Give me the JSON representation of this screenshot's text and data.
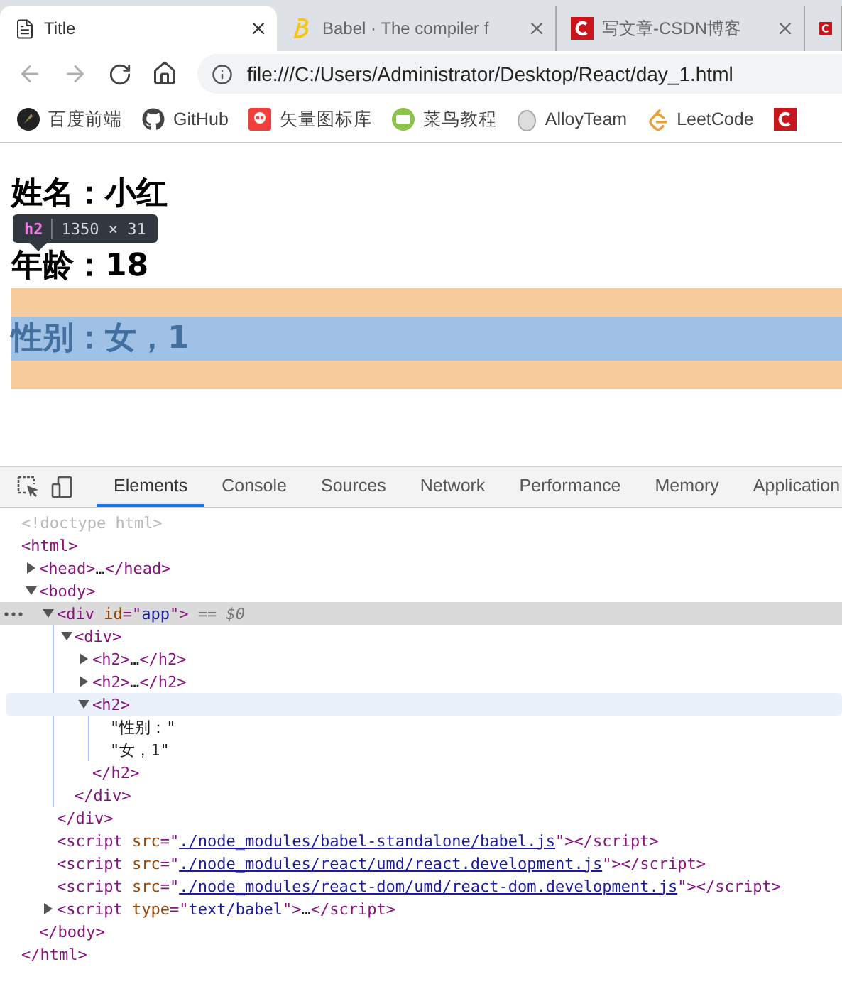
{
  "tabs": [
    {
      "title": "Title",
      "selected": true
    },
    {
      "title": "Babel · The compiler f",
      "selected": false
    },
    {
      "title": "写文章-CSDN博客",
      "selected": false
    },
    {
      "selected": false
    }
  ],
  "address": {
    "url": "file:///C:/Users/Administrator/Desktop/React/day_1.html"
  },
  "bookmarks": [
    {
      "label": "百度前端"
    },
    {
      "label": "GitHub"
    },
    {
      "label": "矢量图标库"
    },
    {
      "label": "菜鸟教程"
    },
    {
      "label": "AlloyTeam"
    },
    {
      "label": "LeetCode"
    }
  ],
  "page": {
    "headings": [
      {
        "text": "姓名：小红",
        "inspected": false
      },
      {
        "text": "年龄：18",
        "inspected": false
      },
      {
        "text": "性别：女，1",
        "inspected": true
      }
    ],
    "tooltip": {
      "tag": "h2",
      "size": "1350 × 31"
    }
  },
  "devtools": {
    "tabs": [
      {
        "label": "Elements",
        "selected": true
      },
      {
        "label": "Console",
        "selected": false
      },
      {
        "label": "Sources",
        "selected": false
      },
      {
        "label": "Network",
        "selected": false
      },
      {
        "label": "Performance",
        "selected": false
      },
      {
        "label": "Memory",
        "selected": false
      },
      {
        "label": "Application",
        "selected": false
      }
    ],
    "dom": [
      {
        "selected": false,
        "hovered": false,
        "line": [
          {
            "kind": "comment",
            "s": "<!doctype html>"
          }
        ]
      },
      {
        "selected": false,
        "hovered": false,
        "line": [
          {
            "kind": "tag",
            "s": "<html>"
          }
        ],
        "close": [
          {
            "kind": "tag",
            "s": "</html>"
          }
        ],
        "children": [
          {
            "expanded": false,
            "selected": false,
            "hovered": false,
            "line": [
              {
                "kind": "tag",
                "s": "<head>"
              },
              {
                "kind": "plain",
                "s": "…"
              },
              {
                "kind": "tag",
                "s": "</head>"
              }
            ]
          },
          {
            "expanded": true,
            "selected": false,
            "hovered": false,
            "line": [
              {
                "kind": "tag",
                "s": "<body>"
              }
            ],
            "close": [
              {
                "kind": "tag",
                "s": "</body>"
              }
            ],
            "children": [
              {
                "expanded": true,
                "selected": true,
                "hovered": false,
                "line": [
                  {
                    "kind": "tag",
                    "s": "<div "
                  },
                  {
                    "kind": "attr",
                    "s": "id"
                  },
                  {
                    "kind": "tag",
                    "s": "=\""
                  },
                  {
                    "kind": "value",
                    "s": "app"
                  },
                  {
                    "kind": "tag",
                    "s": "\">"
                  },
                  {
                    "kind": "note",
                    "s": " == $0"
                  }
                ],
                "close": [
                  {
                    "kind": "tag",
                    "s": "</div>"
                  }
                ],
                "children": [
                  {
                    "expanded": true,
                    "selected": false,
                    "hovered": false,
                    "line": [
                      {
                        "kind": "tag",
                        "s": "<div>"
                      }
                    ],
                    "close": [
                      {
                        "kind": "tag",
                        "s": "</div>"
                      }
                    ],
                    "children": [
                      {
                        "expanded": false,
                        "selected": false,
                        "hovered": false,
                        "line": [
                          {
                            "kind": "tag",
                            "s": "<h2>"
                          },
                          {
                            "kind": "plain",
                            "s": "…"
                          },
                          {
                            "kind": "tag",
                            "s": "</h2>"
                          }
                        ]
                      },
                      {
                        "expanded": false,
                        "selected": false,
                        "hovered": false,
                        "line": [
                          {
                            "kind": "tag",
                            "s": "<h2>"
                          },
                          {
                            "kind": "plain",
                            "s": "…"
                          },
                          {
                            "kind": "tag",
                            "s": "</h2>"
                          }
                        ]
                      },
                      {
                        "expanded": true,
                        "selected": false,
                        "hovered": true,
                        "line": [
                          {
                            "kind": "tag",
                            "s": "<h2>"
                          }
                        ],
                        "close": [
                          {
                            "kind": "tag",
                            "s": "</h2>"
                          }
                        ],
                        "children": [
                          {
                            "selected": false,
                            "hovered": false,
                            "line": [
                              {
                                "kind": "plain",
                                "s": "\"性别：\""
                              }
                            ]
                          },
                          {
                            "selected": false,
                            "hovered": false,
                            "line": [
                              {
                                "kind": "plain",
                                "s": "\"女，1\""
                              }
                            ]
                          }
                        ]
                      }
                    ]
                  }
                ]
              },
              {
                "selected": false,
                "hovered": false,
                "line": [
                  {
                    "kind": "tag",
                    "s": "<script "
                  },
                  {
                    "kind": "attr",
                    "s": "src"
                  },
                  {
                    "kind": "tag",
                    "s": "=\""
                  },
                  {
                    "kind": "link",
                    "s": "./node_modules/babel-standalone/babel.js"
                  },
                  {
                    "kind": "tag",
                    "s": "\"></script>"
                  }
                ]
              },
              {
                "selected": false,
                "hovered": false,
                "line": [
                  {
                    "kind": "tag",
                    "s": "<script "
                  },
                  {
                    "kind": "attr",
                    "s": "src"
                  },
                  {
                    "kind": "tag",
                    "s": "=\""
                  },
                  {
                    "kind": "link",
                    "s": "./node_modules/react/umd/react.development.js"
                  },
                  {
                    "kind": "tag",
                    "s": "\"></script>"
                  }
                ]
              },
              {
                "selected": false,
                "hovered": false,
                "line": [
                  {
                    "kind": "tag",
                    "s": "<script "
                  },
                  {
                    "kind": "attr",
                    "s": "src"
                  },
                  {
                    "kind": "tag",
                    "s": "=\""
                  },
                  {
                    "kind": "link",
                    "s": "./node_modules/react-dom/umd/react-dom.development.js"
                  },
                  {
                    "kind": "tag",
                    "s": "\"></script>"
                  }
                ]
              },
              {
                "expanded": false,
                "selected": false,
                "hovered": false,
                "line": [
                  {
                    "kind": "tag",
                    "s": "<script "
                  },
                  {
                    "kind": "attr",
                    "s": "type"
                  },
                  {
                    "kind": "tag",
                    "s": "=\""
                  },
                  {
                    "kind": "value",
                    "s": "text/babel"
                  },
                  {
                    "kind": "tag",
                    "s": "\">"
                  },
                  {
                    "kind": "plain",
                    "s": "…"
                  },
                  {
                    "kind": "tag",
                    "s": "</script>"
                  }
                ]
              }
            ]
          }
        ]
      }
    ]
  }
}
